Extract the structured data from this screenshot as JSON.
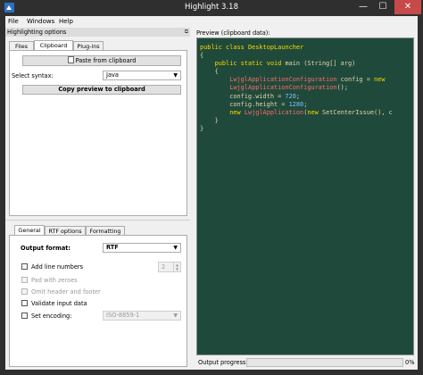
{
  "window": {
    "title": "Highlight 3.18"
  },
  "menu": [
    "File",
    "Windows",
    "Help"
  ],
  "dock": {
    "title": "Highlighting options",
    "float_symbol": "⧉"
  },
  "top_tabs": [
    "Files",
    "Clipboard",
    "Plug-ins"
  ],
  "clipboard": {
    "paste_button": "Paste from clipboard",
    "syntax_label": "Select syntax:",
    "syntax_value": "Java",
    "copy_button": "Copy preview to clipboard"
  },
  "bottom_tabs": [
    "General",
    "RTF options",
    "Formatting"
  ],
  "general": {
    "output_format_label": "Output format:",
    "output_format_value": "RTF",
    "line_numbers_label": "Add line numbers",
    "line_numbers_value": "2",
    "pad_zeroes_label": "Pad with zeroes",
    "omit_header_label": "Omit header and footer",
    "validate_label": "Validate input data",
    "encoding_label": "Set encoding:",
    "encoding_value": "ISO-8859-1"
  },
  "preview": {
    "label": "Preview (clipboard data):",
    "code_lines": [
      [
        [
          "kw",
          "public "
        ],
        [
          "kw",
          "class "
        ],
        [
          "ty",
          "DesktopLauncher"
        ]
      ],
      [
        [
          "br",
          "{"
        ]
      ],
      [
        [
          "br",
          "    "
        ],
        [
          "kw",
          "public "
        ],
        [
          "kw",
          "static "
        ],
        [
          "kw",
          "void "
        ],
        [
          "br",
          "main (String[] arg)"
        ]
      ],
      [
        [
          "br",
          "    {"
        ]
      ],
      [
        [
          "br",
          "        "
        ],
        [
          "fn",
          "LwjglApplicationConfiguration"
        ],
        [
          "br",
          " config = "
        ],
        [
          "kw",
          "new"
        ]
      ],
      [
        [
          "br",
          "        "
        ],
        [
          "fn",
          "LwjglApplicationConfiguration"
        ],
        [
          "br",
          "();"
        ]
      ],
      [
        [
          "br",
          "        config.width = "
        ],
        [
          "nm",
          "720"
        ],
        [
          "br",
          ";"
        ]
      ],
      [
        [
          "br",
          "        config.height = "
        ],
        [
          "nm",
          "1280"
        ],
        [
          "br",
          ";"
        ]
      ],
      [
        [
          "br",
          "        "
        ],
        [
          "kw",
          "new "
        ],
        [
          "fn",
          "LwjglApplication"
        ],
        [
          "br",
          "("
        ],
        [
          "kw",
          "new "
        ],
        [
          "br",
          "SetCenterIssue(), c"
        ]
      ],
      [
        [
          "br",
          "    }"
        ]
      ],
      [
        [
          "br",
          "}"
        ]
      ]
    ]
  },
  "progress": {
    "label": "Output progress:",
    "value": 0,
    "percent_text": "0%"
  },
  "colors": {
    "editor_bg": "#1f4a3b",
    "keyword": "#ffd700",
    "number": "#7fbfff",
    "class_name": "#ff6a6a",
    "text": "#e6d3ad",
    "progress_fill": "#06b025"
  },
  "icons": [
    "app-icon",
    "minimize-icon",
    "maximize-icon",
    "close-icon",
    "float-icon",
    "dropdown-arrow-icon",
    "spin-arrows-icon"
  ]
}
